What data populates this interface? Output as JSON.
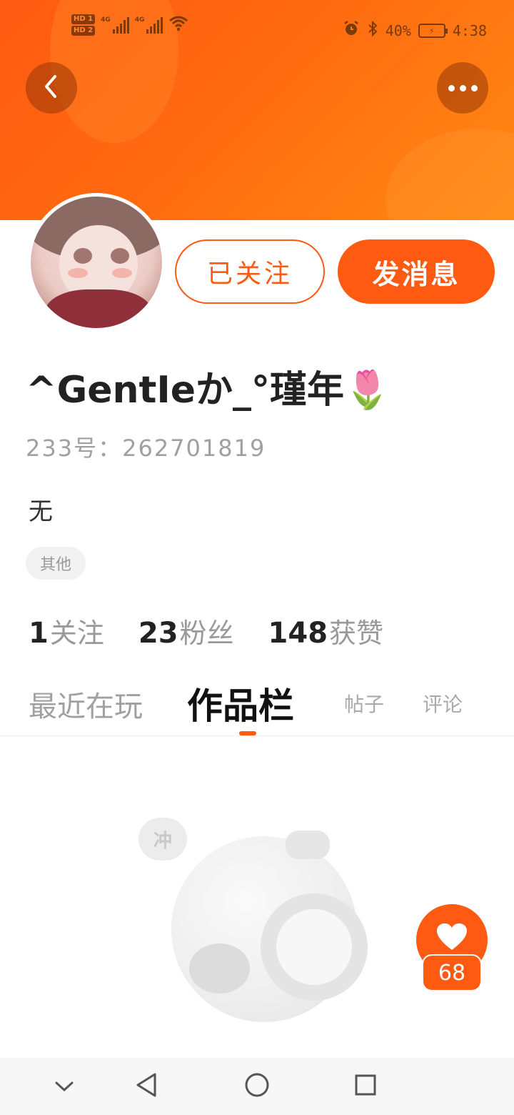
{
  "status_bar": {
    "hd1": "HD 1",
    "hd2": "HD 2",
    "net1": "4G",
    "net2": "4G",
    "battery_percent": "40%",
    "time": "4:38"
  },
  "profile": {
    "username": "^GentIeか_°瑾年🌷",
    "id_label": "233号：",
    "id_value": "262701819",
    "bio": "无",
    "tag": "其他"
  },
  "actions": {
    "followed_label": "已关注",
    "message_label": "发消息"
  },
  "stats": {
    "following_count": "1",
    "following_label": "关注",
    "fans_count": "23",
    "fans_label": "粉丝",
    "likes_count": "148",
    "likes_label": "获赞"
  },
  "tabs": {
    "recent": "最近在玩",
    "works": "作品栏",
    "posts": "帖子",
    "comments": "评论",
    "active": "works"
  },
  "empty_state": {
    "bubble_text": "冲"
  },
  "like_fab": {
    "count": "68"
  },
  "colors": {
    "accent": "#ff5a12",
    "banner_start": "#ff5a12",
    "banner_end": "#ff8a14"
  }
}
